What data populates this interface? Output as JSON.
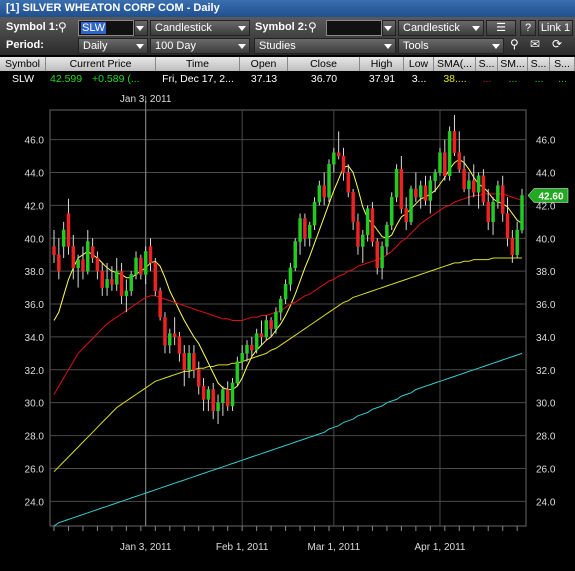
{
  "window": {
    "title": "[1] SILVER WHEATON CORP COM - Daily"
  },
  "toolbar": {
    "symbol1_label": "Symbol 1:",
    "symbol1_value": "SLW",
    "chart_type1": "Candlestick",
    "symbol2_label": "Symbol 2:",
    "symbol2_value": "",
    "chart_type2": "Candlestick",
    "help_label": "?",
    "link_label": "Link 1",
    "period_label": "Period:",
    "period_value": "Daily",
    "range_value": "100 Day",
    "studies_value": "Studies",
    "tools_value": "Tools"
  },
  "quote": {
    "headers": [
      "Symbol",
      "Current Price",
      "Time",
      "Open",
      "Close",
      "High",
      "Low",
      "SMA(...",
      "S...",
      "SM...",
      "S...",
      "S..."
    ],
    "symbol": "SLW",
    "price": "42.599",
    "change": "+0.589 (...",
    "time": "Fri, Dec 17, 2...",
    "open": "37.13",
    "close": "36.70",
    "high": "37.91",
    "low": "3...",
    "sma1": "38....",
    "s2": "...",
    "s3": "...",
    "s4": "...",
    "s5": "...",
    "colors": {
      "price": "#22dd22",
      "change": "#22dd22",
      "sma1": "#e6e600",
      "s2": "#e02020",
      "s3": "#22dd22",
      "s4": "#22dd22",
      "s5": "#22dd22"
    }
  },
  "chart_data": {
    "type": "candlestick",
    "symbol": "SLW",
    "ylim": [
      22.5,
      47.8
    ],
    "yticks": [
      24.0,
      26.0,
      28.0,
      30.0,
      32.0,
      34.0,
      36.0,
      38.0,
      40.0,
      42.0,
      44.0,
      46.0
    ],
    "ytick_labels": [
      "24.0",
      "26.0",
      "28.0",
      "30.0",
      "32.0",
      "34.0",
      "36.0",
      "38.0",
      "40.0",
      "42.0",
      "44.0",
      "46.0"
    ],
    "x_tick_labels": [
      "Jan 3, 2011",
      "Feb 1, 2011",
      "Mar 1, 2011",
      "Apr 1, 2011"
    ],
    "x_tick_index": [
      19,
      39,
      58,
      80
    ],
    "crosshair_label": "Jan 3, 2011",
    "crosshair_index": 19,
    "last_price_label": "42.60",
    "last_price": 42.6,
    "grid": true,
    "colors": {
      "up": "#22cc22",
      "down": "#ee2222",
      "sma_yellow_fast": "#ffff55",
      "sma_red": "#dd1111",
      "sma_yellow_slow": "#dddd22",
      "sma_cyan": "#33cccc",
      "last_price_bg": "#22aa22"
    },
    "ohlc": [
      [
        39.5,
        40.5,
        38.5,
        39.0
      ],
      [
        39.0,
        40.0,
        37.5,
        38.0
      ],
      [
        39.5,
        41.0,
        38.8,
        40.5
      ],
      [
        41.5,
        42.4,
        39.0,
        39.5
      ],
      [
        39.5,
        40.2,
        37.5,
        38.2
      ],
      [
        38.2,
        39.0,
        37.0,
        38.7
      ],
      [
        38.7,
        39.5,
        37.5,
        38.0
      ],
      [
        38.0,
        40.5,
        37.8,
        39.8
      ],
      [
        39.5,
        40.0,
        38.5,
        38.8
      ],
      [
        38.8,
        39.2,
        37.5,
        38.0
      ],
      [
        38.0,
        38.5,
        36.5,
        37.0
      ],
      [
        37.0,
        38.5,
        36.5,
        37.5
      ],
      [
        37.5,
        38.3,
        36.8,
        37.2
      ],
      [
        37.2,
        38.8,
        36.8,
        38.0
      ],
      [
        38.0,
        38.5,
        36.0,
        36.5
      ],
      [
        36.5,
        37.5,
        35.5,
        36.8
      ],
      [
        36.8,
        38.0,
        36.5,
        37.8
      ],
      [
        37.8,
        39.2,
        37.5,
        38.8
      ],
      [
        38.8,
        39.0,
        37.5,
        37.8
      ],
      [
        37.8,
        39.5,
        37.2,
        39.2
      ],
      [
        39.5,
        40.0,
        38.0,
        38.5
      ],
      [
        38.5,
        38.8,
        36.5,
        36.8
      ],
      [
        36.8,
        37.0,
        35.0,
        35.2
      ],
      [
        35.2,
        35.5,
        33.0,
        33.5
      ],
      [
        33.5,
        34.5,
        33.0,
        34.2
      ],
      [
        34.2,
        35.2,
        33.5,
        34.0
      ],
      [
        34.0,
        34.3,
        32.5,
        33.0
      ],
      [
        33.0,
        33.5,
        31.0,
        32.0
      ],
      [
        32.0,
        33.5,
        31.5,
        33.0
      ],
      [
        33.0,
        33.5,
        31.5,
        32.0
      ],
      [
        32.0,
        32.5,
        30.5,
        31.0
      ],
      [
        31.0,
        31.5,
        29.5,
        30.2
      ],
      [
        30.2,
        31.0,
        29.5,
        30.8
      ],
      [
        30.8,
        31.2,
        29.0,
        29.5
      ],
      [
        29.5,
        30.5,
        28.7,
        30.0
      ],
      [
        30.0,
        31.0,
        29.2,
        30.8
      ],
      [
        30.8,
        31.3,
        29.5,
        29.8
      ],
      [
        29.8,
        31.5,
        29.5,
        31.2
      ],
      [
        31.2,
        32.8,
        31.0,
        32.5
      ],
      [
        32.5,
        33.5,
        32.0,
        33.0
      ],
      [
        33.0,
        33.8,
        32.5,
        33.5
      ],
      [
        33.5,
        34.0,
        32.8,
        33.2
      ],
      [
        33.2,
        34.5,
        33.0,
        34.2
      ],
      [
        34.2,
        35.0,
        33.5,
        34.0
      ],
      [
        34.0,
        35.3,
        33.8,
        35.0
      ],
      [
        35.0,
        35.2,
        34.0,
        34.5
      ],
      [
        34.5,
        35.8,
        34.2,
        35.5
      ],
      [
        35.5,
        36.5,
        35.0,
        36.3
      ],
      [
        36.3,
        37.5,
        36.0,
        37.2
      ],
      [
        37.2,
        38.5,
        36.8,
        38.2
      ],
      [
        38.2,
        40.0,
        38.0,
        39.8
      ],
      [
        39.8,
        41.5,
        39.0,
        41.2
      ],
      [
        41.2,
        41.5,
        39.5,
        40.0
      ],
      [
        40.0,
        41.0,
        39.5,
        40.8
      ],
      [
        40.8,
        42.5,
        40.5,
        42.2
      ],
      [
        42.2,
        43.5,
        42.0,
        43.2
      ],
      [
        43.2,
        44.0,
        42.0,
        42.5
      ],
      [
        42.5,
        44.8,
        42.2,
        44.5
      ],
      [
        44.5,
        45.5,
        44.0,
        45.2
      ],
      [
        45.2,
        46.5,
        44.8,
        45.0
      ],
      [
        45.0,
        45.5,
        43.5,
        44.0
      ],
      [
        44.0,
        44.5,
        42.5,
        42.8
      ],
      [
        42.8,
        43.0,
        40.5,
        41.0
      ],
      [
        41.0,
        41.5,
        39.0,
        39.5
      ],
      [
        39.5,
        40.5,
        38.5,
        40.2
      ],
      [
        40.2,
        42.0,
        39.8,
        41.8
      ],
      [
        41.8,
        42.2,
        39.5,
        39.8
      ],
      [
        39.8,
        40.0,
        37.8,
        38.2
      ],
      [
        38.2,
        39.8,
        37.5,
        39.5
      ],
      [
        39.5,
        41.0,
        39.0,
        40.8
      ],
      [
        40.8,
        42.8,
        40.5,
        42.5
      ],
      [
        42.5,
        44.5,
        42.2,
        44.2
      ],
      [
        44.2,
        45.0,
        41.5,
        41.8
      ],
      [
        41.8,
        42.5,
        40.5,
        41.0
      ],
      [
        41.0,
        43.2,
        40.8,
        43.0
      ],
      [
        43.0,
        44.0,
        42.2,
        42.5
      ],
      [
        42.5,
        43.5,
        41.8,
        43.2
      ],
      [
        43.2,
        43.8,
        42.0,
        42.3
      ],
      [
        42.3,
        43.8,
        41.5,
        43.5
      ],
      [
        43.5,
        44.2,
        42.8,
        44.0
      ],
      [
        44.0,
        45.5,
        43.8,
        45.2
      ],
      [
        45.2,
        46.0,
        43.5,
        43.8
      ],
      [
        43.8,
        46.8,
        43.5,
        46.5
      ],
      [
        46.5,
        47.5,
        45.0,
        45.2
      ],
      [
        45.2,
        46.5,
        44.0,
        44.2
      ],
      [
        44.2,
        45.0,
        42.8,
        43.0
      ],
      [
        43.0,
        44.0,
        42.0,
        43.5
      ],
      [
        43.5,
        44.5,
        42.5,
        42.8
      ],
      [
        42.8,
        44.0,
        41.8,
        43.8
      ],
      [
        43.8,
        44.2,
        42.0,
        42.2
      ],
      [
        42.2,
        43.0,
        40.5,
        41.0
      ],
      [
        41.0,
        42.5,
        40.2,
        42.2
      ],
      [
        42.2,
        43.5,
        41.8,
        43.2
      ],
      [
        43.2,
        43.8,
        41.0,
        41.5
      ],
      [
        41.5,
        42.5,
        39.5,
        40.0
      ],
      [
        40.0,
        40.5,
        38.5,
        39.0
      ],
      [
        39.0,
        41.0,
        38.8,
        40.5
      ],
      [
        40.5,
        43.0,
        40.3,
        42.6
      ]
    ],
    "series": [
      {
        "color": "#ffff55",
        "values": [
          35.0,
          35.5,
          36.5,
          37.5,
          38.2,
          38.8,
          39.0,
          39.2,
          39.0,
          38.8,
          38.5,
          38.2,
          38.0,
          37.9,
          37.8,
          37.6,
          37.6,
          37.8,
          38.0,
          38.2,
          38.5,
          38.6,
          38.3,
          37.6,
          36.8,
          36.2,
          35.6,
          35.0,
          34.5,
          34.0,
          33.6,
          33.0,
          32.4,
          31.8,
          31.2,
          30.9,
          30.8,
          30.8,
          31.0,
          31.5,
          32.2,
          32.8,
          33.2,
          33.5,
          33.8,
          34.0,
          34.4,
          34.8,
          35.3,
          35.9,
          36.6,
          37.4,
          38.2,
          38.9,
          39.7,
          40.5,
          41.3,
          42.1,
          42.9,
          43.6,
          44.3,
          44.4,
          44.0,
          43.0,
          41.9,
          41.2,
          40.9,
          40.5,
          40.1,
          40.0,
          40.2,
          40.8,
          41.3,
          41.5,
          41.8,
          42.1,
          42.4,
          42.5,
          42.7,
          42.9,
          43.3,
          43.7,
          44.2,
          44.6,
          44.8,
          44.6,
          44.2,
          43.7,
          43.3,
          43.1,
          42.8,
          42.4,
          42.2,
          42.1,
          41.9,
          41.5,
          41.1,
          40.9
        ]
      },
      {
        "color": "#dd1111",
        "values": [
          30.5,
          31.0,
          31.5,
          32.0,
          32.5,
          33.0,
          33.3,
          33.6,
          33.9,
          34.2,
          34.5,
          34.8,
          35.0,
          35.2,
          35.4,
          35.6,
          35.8,
          36.0,
          36.2,
          36.4,
          36.5,
          36.5,
          36.4,
          36.3,
          36.2,
          36.1,
          36.0,
          35.9,
          35.8,
          35.7,
          35.6,
          35.5,
          35.4,
          35.3,
          35.2,
          35.1,
          35.1,
          35.0,
          35.0,
          35.0,
          35.1,
          35.2,
          35.2,
          35.3,
          35.3,
          35.4,
          35.5,
          35.6,
          35.8,
          36.0,
          36.1,
          36.3,
          36.5,
          36.6,
          36.8,
          37.0,
          37.2,
          37.4,
          37.5,
          37.7,
          37.8,
          38.0,
          38.1,
          38.3,
          38.4,
          38.5,
          38.6,
          38.7,
          38.8,
          39.0,
          39.2,
          39.5,
          39.8,
          40.0,
          40.3,
          40.6,
          40.9,
          41.1,
          41.3,
          41.5,
          41.7,
          41.9,
          42.0,
          42.2,
          42.3,
          42.4,
          42.5,
          42.6,
          42.6,
          42.7,
          42.7,
          42.7,
          42.7,
          42.7,
          42.6,
          42.5,
          42.4,
          42.3
        ]
      },
      {
        "color": "#dddd22",
        "values": [
          25.8,
          26.1,
          26.4,
          26.7,
          27.0,
          27.3,
          27.6,
          27.9,
          28.2,
          28.5,
          28.8,
          29.1,
          29.4,
          29.7,
          29.9,
          30.1,
          30.3,
          30.5,
          30.7,
          30.9,
          31.1,
          31.3,
          31.4,
          31.5,
          31.6,
          31.7,
          31.8,
          31.9,
          31.9,
          32.0,
          32.1,
          32.1,
          32.2,
          32.2,
          32.3,
          32.3,
          32.3,
          32.4,
          32.4,
          32.5,
          32.6,
          32.7,
          32.8,
          32.9,
          33.0,
          33.2,
          33.3,
          33.5,
          33.7,
          33.9,
          34.1,
          34.3,
          34.5,
          34.7,
          34.9,
          35.1,
          35.3,
          35.5,
          35.7,
          35.9,
          36.1,
          36.2,
          36.4,
          36.5,
          36.6,
          36.7,
          36.8,
          36.9,
          37.0,
          37.1,
          37.2,
          37.3,
          37.4,
          37.5,
          37.6,
          37.7,
          37.8,
          37.9,
          38.0,
          38.1,
          38.2,
          38.3,
          38.4,
          38.5,
          38.5,
          38.6,
          38.6,
          38.7,
          38.7,
          38.7,
          38.7,
          38.8,
          38.8,
          38.8,
          38.8,
          38.8,
          38.8,
          38.8
        ]
      },
      {
        "color": "#33cccc",
        "values": [
          22.5,
          22.7,
          22.8,
          22.9,
          23.0,
          23.1,
          23.2,
          23.3,
          23.4,
          23.5,
          23.6,
          23.7,
          23.8,
          23.9,
          24.0,
          24.1,
          24.2,
          24.3,
          24.4,
          24.5,
          24.6,
          24.7,
          24.8,
          24.9,
          25.0,
          25.1,
          25.2,
          25.3,
          25.4,
          25.5,
          25.6,
          25.7,
          25.8,
          25.9,
          26.0,
          26.1,
          26.2,
          26.3,
          26.4,
          26.5,
          26.6,
          26.7,
          26.8,
          26.9,
          27.0,
          27.1,
          27.2,
          27.3,
          27.4,
          27.5,
          27.6,
          27.7,
          27.8,
          27.9,
          28.0,
          28.1,
          28.2,
          28.4,
          28.5,
          28.6,
          28.8,
          28.9,
          29.0,
          29.2,
          29.3,
          29.4,
          29.6,
          29.7,
          29.8,
          30.0,
          30.1,
          30.2,
          30.4,
          30.5,
          30.6,
          30.8,
          30.9,
          31.0,
          31.1,
          31.2,
          31.3,
          31.4,
          31.5,
          31.6,
          31.7,
          31.8,
          31.9,
          32.0,
          32.1,
          32.2,
          32.3,
          32.4,
          32.5,
          32.6,
          32.7,
          32.8,
          32.9,
          33.0
        ]
      }
    ]
  }
}
